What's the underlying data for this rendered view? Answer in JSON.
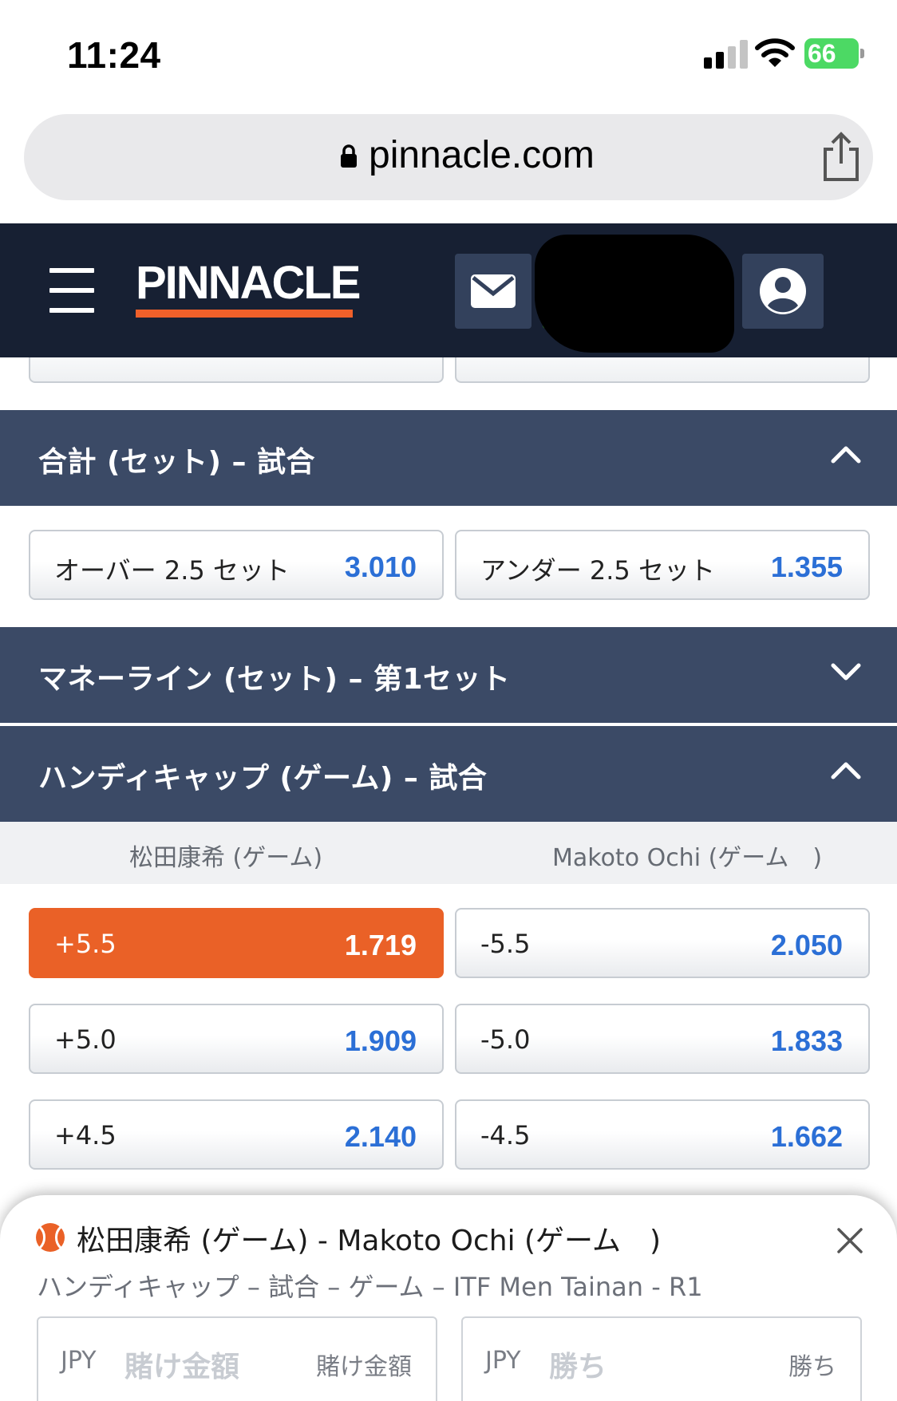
{
  "status_bar": {
    "time": "11:24",
    "battery": "66"
  },
  "browser": {
    "url": "pinnacle.com"
  },
  "header": {
    "logo": "PINNACLE"
  },
  "sections": {
    "totals": {
      "title": "合計 (セット) – 試合"
    },
    "moneyline": {
      "title": "マネーライン (セット) – 第1セット"
    },
    "handicap": {
      "title": "ハンディキャップ (ゲーム) – 試合"
    }
  },
  "totals_odds": [
    {
      "label": "オーバー 2.5 セット",
      "value": "3.010"
    },
    {
      "label": "アンダー 2.5 セット",
      "value": "1.355"
    }
  ],
  "handicap_columns": {
    "home": "松田康希 (ゲーム)",
    "away": "Makoto Ochi (ゲーム　)"
  },
  "handicap_rows": [
    {
      "home_line": "+5.5",
      "home_odds": "1.719",
      "away_line": "-5.5",
      "away_odds": "2.050"
    },
    {
      "home_line": "+5.0",
      "home_odds": "1.909",
      "away_line": "-5.0",
      "away_odds": "1.833"
    },
    {
      "home_line": "+4.5",
      "home_odds": "2.140",
      "away_line": "-4.5",
      "away_odds": "1.662"
    }
  ],
  "bet_slip": {
    "title": "松田康希 (ゲーム) - Makoto Ochi (ゲーム　)",
    "subtitle": "ハンディキャップ – 試合 – ゲーム – ITF Men Tainan - R1",
    "stake": {
      "currency": "JPY",
      "placeholder": "賭け金額",
      "hint": "賭け金額"
    },
    "win": {
      "currency": "JPY",
      "placeholder": "勝ち",
      "hint": "勝ち"
    }
  },
  "colors": {
    "header_bg": "#172033",
    "section_bg": "#3b4a66",
    "accent": "#ea6127",
    "odds": "#2b6fd6"
  },
  "icons": [
    "signal-icon",
    "wifi-icon",
    "lock-icon",
    "share-icon",
    "menu-icon",
    "mail-icon",
    "account-icon",
    "chevron-up-icon",
    "chevron-down-icon",
    "tennis-ball-icon",
    "close-icon"
  ]
}
